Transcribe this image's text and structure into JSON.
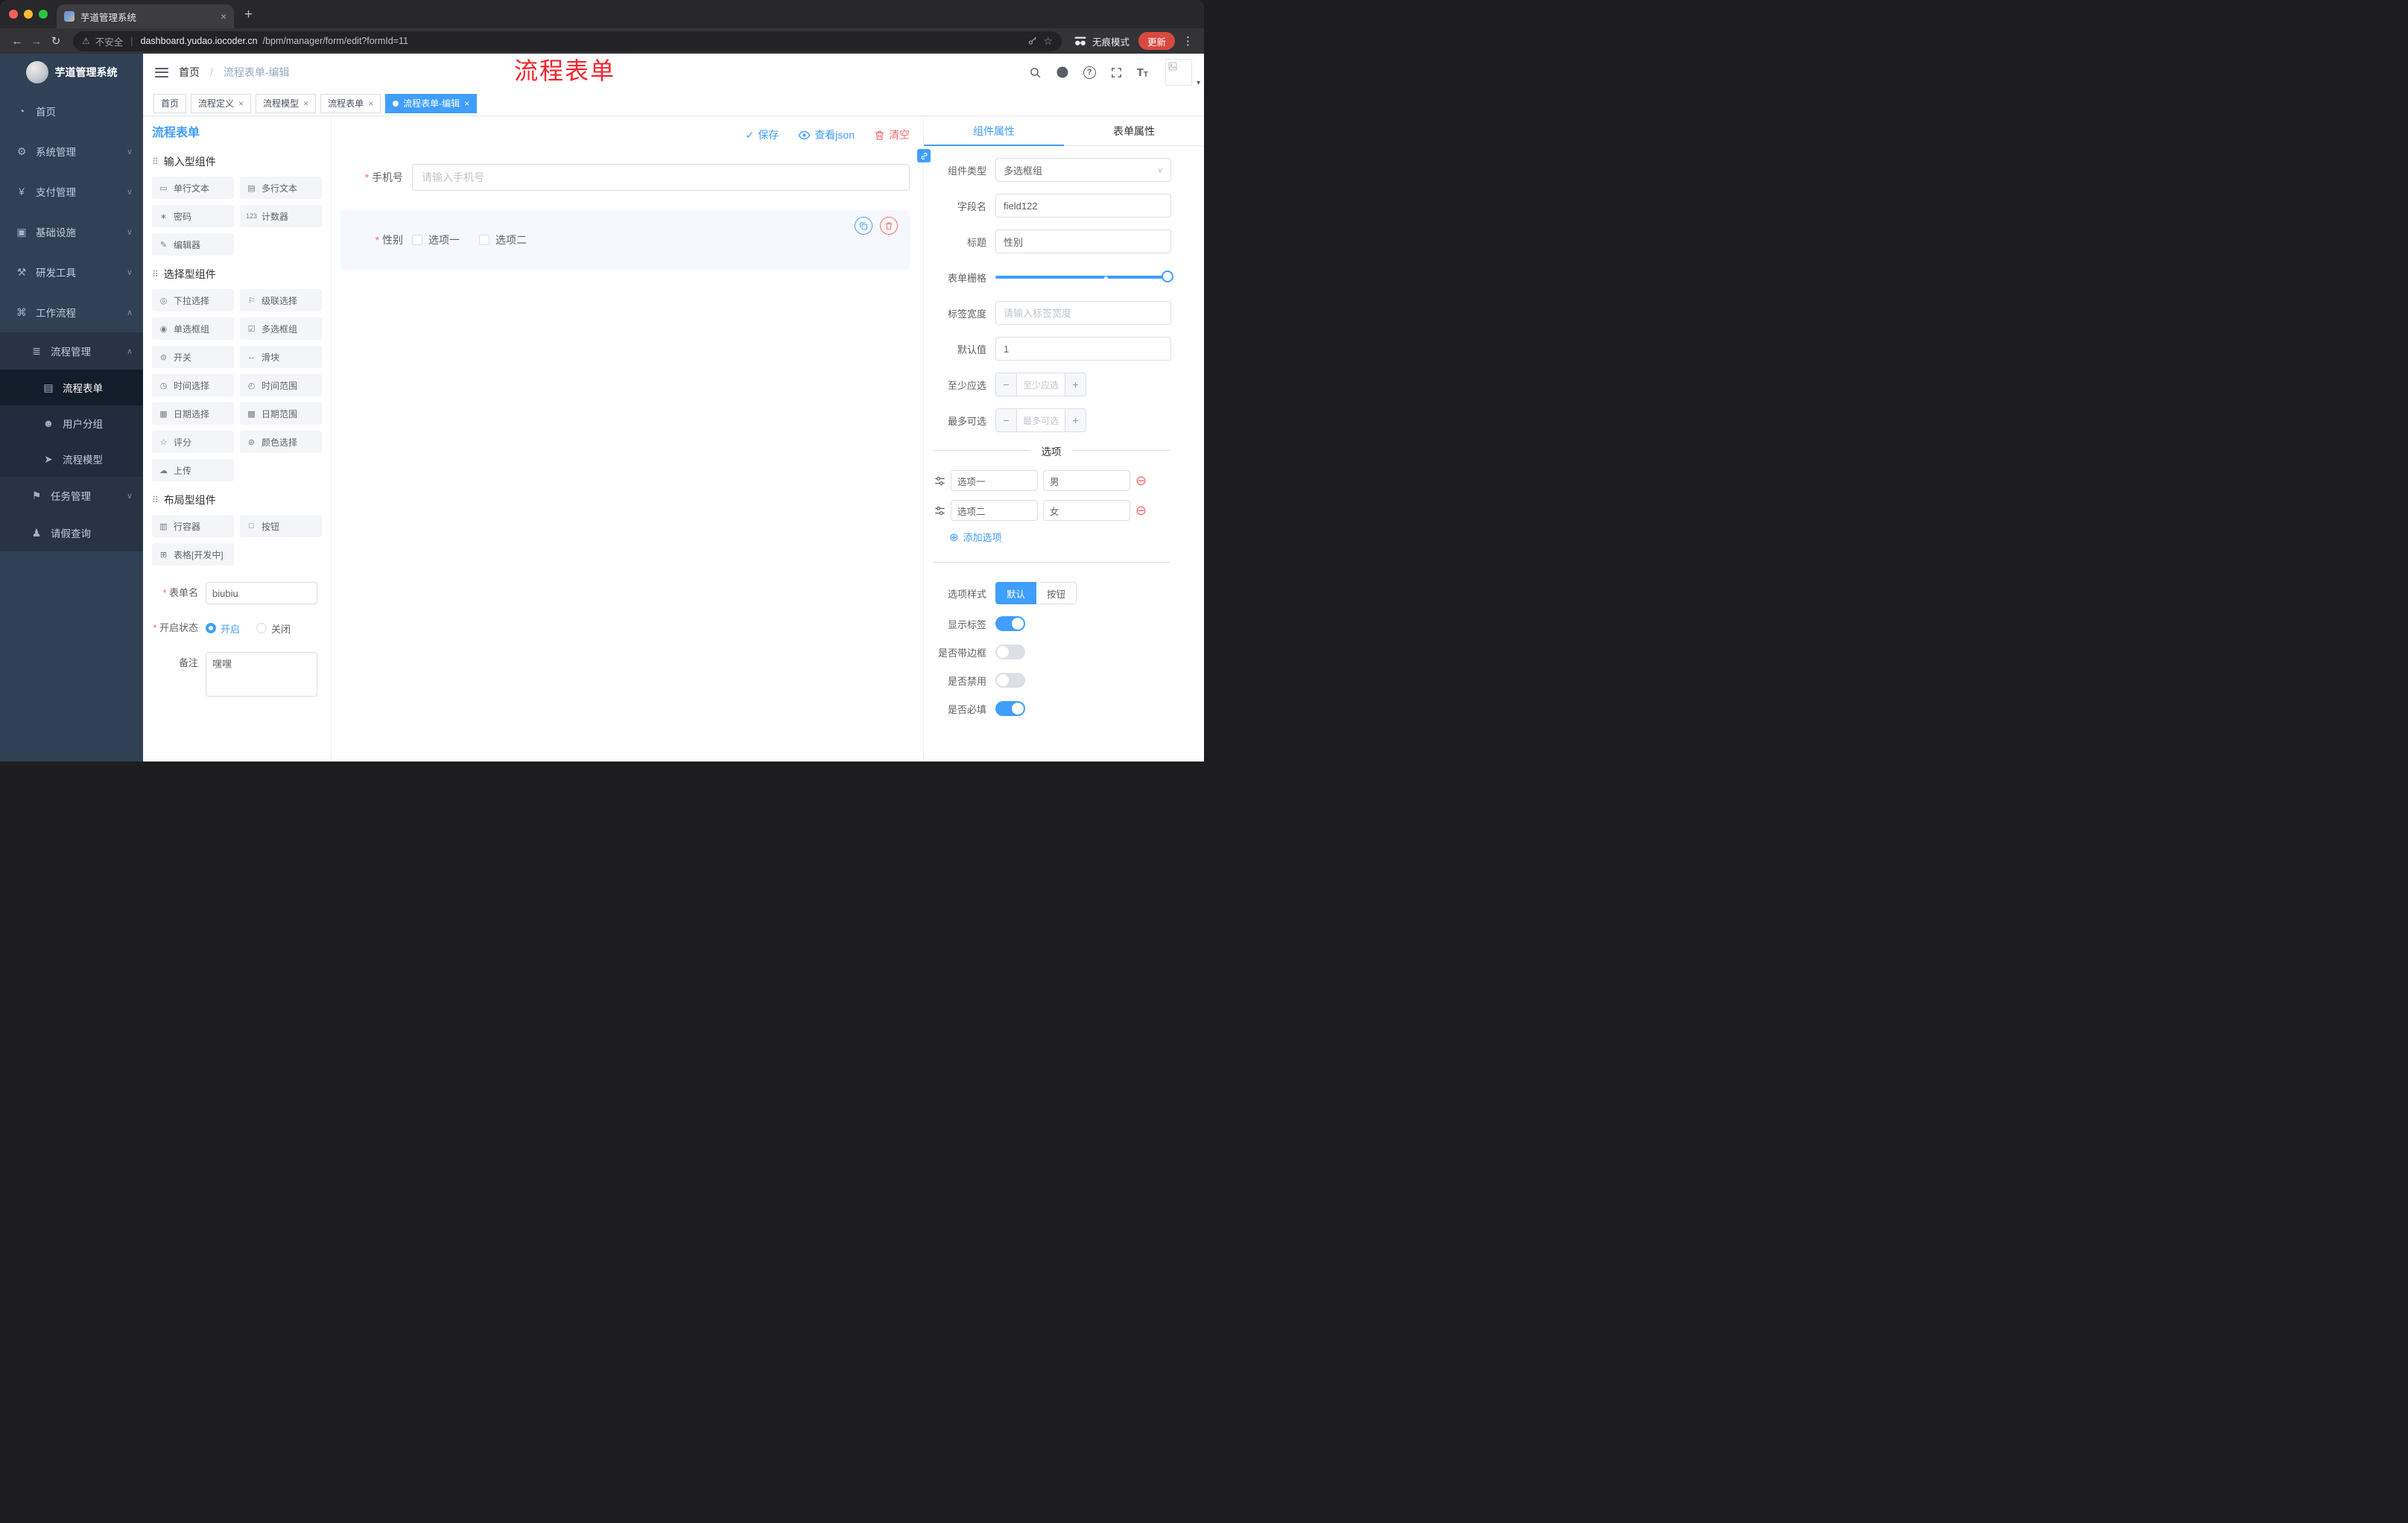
{
  "colors": {
    "accent": "#409EFF",
    "danger": "#F56C6C",
    "annotation": "#F5222D",
    "sidebar_bg": "#304156"
  },
  "browser": {
    "tab_title": "芋道管理系统",
    "security_text": "不安全",
    "url_host": "dashboard.yudao.iocoder.cn",
    "url_path": "/bpm/manager/form/edit?formId=11",
    "incognito_label": "无痕模式",
    "update_label": "更新"
  },
  "sidebar": {
    "logo_title": "芋道管理系统",
    "menu": [
      {
        "label": "首页",
        "glyph": "◔"
      },
      {
        "label": "系统管理",
        "glyph": "⚙"
      },
      {
        "label": "支付管理",
        "glyph": "¥"
      },
      {
        "label": "基础设施",
        "glyph": "▣"
      },
      {
        "label": "研发工具",
        "glyph": "⚒"
      },
      {
        "label": "工作流程",
        "glyph": "⌘"
      },
      {
        "label": "流程管理",
        "glyph": "≣"
      },
      {
        "label": "流程表单",
        "glyph": "▤"
      },
      {
        "label": "用户分组",
        "glyph": "☻"
      },
      {
        "label": "流程模型",
        "glyph": "➤"
      },
      {
        "label": "任务管理",
        "glyph": "⚑"
      },
      {
        "label": "请假查询",
        "glyph": "♟"
      }
    ]
  },
  "navbar": {
    "breadcrumb_home": "首页",
    "breadcrumb_sep": "/",
    "breadcrumb_current": "流程表单-编辑",
    "annotation": "流程表单"
  },
  "tags": [
    {
      "label": "首页"
    },
    {
      "label": "流程定义"
    },
    {
      "label": "流程模型"
    },
    {
      "label": "流程表单"
    },
    {
      "label": "流程表单-编辑"
    }
  ],
  "designer": {
    "panel_title": "流程表单",
    "toolbar": {
      "save": "保存",
      "view_json": "查看json",
      "clear": "清空"
    },
    "groups": [
      {
        "title": "输入型组件",
        "items": [
          {
            "label": "单行文本",
            "glyph": "▭"
          },
          {
            "label": "多行文本",
            "glyph": "▤"
          },
          {
            "label": "密码",
            "glyph": "∗"
          },
          {
            "label": "计数器",
            "glyph": "123"
          },
          {
            "label": "编辑器",
            "glyph": "✎"
          }
        ]
      },
      {
        "title": "选择型组件",
        "items": [
          {
            "label": "下拉选择",
            "glyph": "◎"
          },
          {
            "label": "级联选择",
            "glyph": "⚐"
          },
          {
            "label": "单选框组",
            "glyph": "◉"
          },
          {
            "label": "多选框组",
            "glyph": "☑"
          },
          {
            "label": "开关",
            "glyph": "⊜"
          },
          {
            "label": "滑块",
            "glyph": "↔"
          },
          {
            "label": "时间选择",
            "glyph": "◷"
          },
          {
            "label": "时间范围",
            "glyph": "◴"
          },
          {
            "label": "日期选择",
            "glyph": "▦"
          },
          {
            "label": "日期范围",
            "glyph": "▩"
          },
          {
            "label": "评分",
            "glyph": "☆"
          },
          {
            "label": "颜色选择",
            "glyph": "⊛"
          },
          {
            "label": "上传",
            "glyph": "☁"
          }
        ]
      },
      {
        "title": "布局型组件",
        "items": [
          {
            "label": "行容器",
            "glyph": "▥"
          },
          {
            "label": "按钮",
            "glyph": "□"
          },
          {
            "label": "表格[开发中]",
            "glyph": "⊞"
          }
        ]
      }
    ],
    "meta": {
      "name_label": "表单名",
      "name_value": "biubiu",
      "status_label": "开启状态",
      "status_on": "开启",
      "status_off": "关闭",
      "remark_label": "备注",
      "remark_value": "嘿嘿"
    },
    "canvas": {
      "phone_label": "手机号",
      "phone_placeholder": "请输入手机号",
      "gender_label": "性别",
      "gender_opt1": "选项一",
      "gender_opt2": "选项二"
    }
  },
  "props": {
    "tab_component": "组件属性",
    "tab_form": "表单属性",
    "type_label": "组件类型",
    "type_value": "多选框组",
    "field_label": "字段名",
    "field_value": "field122",
    "title_label": "标题",
    "title_value": "性别",
    "grid_label": "表单栅格",
    "label_width_label": "标签宽度",
    "label_width_placeholder": "请输入标签宽度",
    "default_label": "默认值",
    "default_value": "1",
    "min_label": "至少应选",
    "min_placeholder": "至少应选",
    "max_label": "最多可选",
    "max_placeholder": "最多可选",
    "options_title": "选项",
    "options": [
      {
        "label": "选项一",
        "value": "男"
      },
      {
        "label": "选项二",
        "value": "女"
      }
    ],
    "add_option": "添加选项",
    "style_label": "选项样式",
    "style_default": "默认",
    "style_button": "按钮",
    "toggles": [
      {
        "label": "显示标签",
        "on": true
      },
      {
        "label": "是否带边框",
        "on": false
      },
      {
        "label": "是否禁用",
        "on": false
      },
      {
        "label": "是否必填",
        "on": true
      }
    ]
  }
}
